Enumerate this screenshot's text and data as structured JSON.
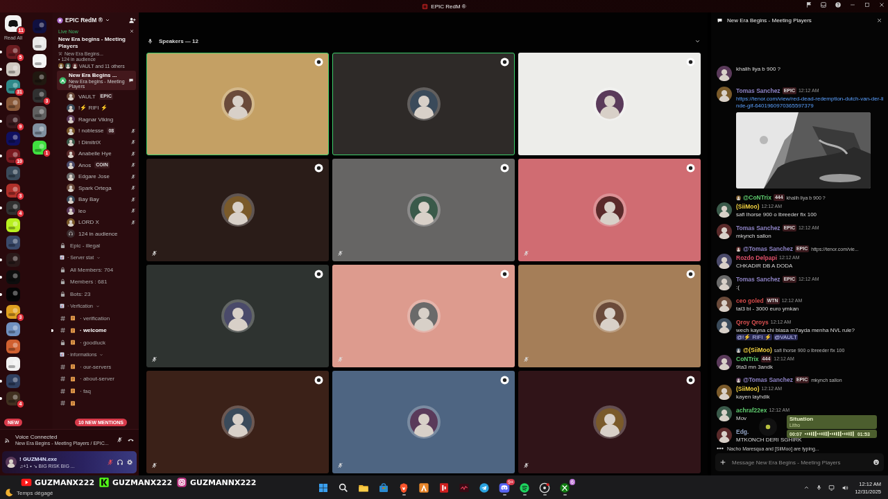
{
  "title_bar": {
    "title": "EPIC RedM ®"
  },
  "server_rail": {
    "home_badge": "11",
    "read_all": "Read All",
    "new_label": "NEW",
    "servers": [
      {
        "color": "#6b1c20",
        "badge": "5",
        "unread": true
      },
      {
        "color": "#cfcac2",
        "unread": true
      },
      {
        "color": "#2f8a8a",
        "badge": "31",
        "unread": true
      },
      {
        "color": "#8a5a3a",
        "unread": true
      },
      {
        "color": "#3a1a1e",
        "badge": "9",
        "unread": true
      },
      {
        "color": "#101060",
        "unread": false
      },
      {
        "color": "#7a1a20",
        "badge": "10",
        "unread": true
      },
      {
        "color": "#3a4a5a",
        "unread": false
      },
      {
        "color": "#b0302a",
        "badge": "3",
        "unread": true
      },
      {
        "color": "#303030",
        "badge": "4",
        "unread": true
      },
      {
        "color": "#b8f020",
        "unread": false
      },
      {
        "color": "#3a4a6a",
        "unread": false
      },
      {
        "color": "#2a1a1a",
        "unread": true
      },
      {
        "color": "#0d0d0d",
        "unread": true
      },
      {
        "color": "#050505",
        "unread": true
      },
      {
        "color": "#e0a020",
        "badge": "3",
        "unread": true
      },
      {
        "color": "#7090c0",
        "unread": false
      },
      {
        "color": "#d06030",
        "unread": false
      },
      {
        "color": "#f0f0f0",
        "unread": false
      },
      {
        "color": "#304060",
        "unread": true
      },
      {
        "color": "#403020",
        "badge": "4",
        "unread": true
      }
    ],
    "folder_servers": [
      {
        "color": "#101040"
      },
      {
        "color": "#e8e8e8"
      },
      {
        "color": "#f4f4f4"
      },
      {
        "color": "#201810"
      },
      {
        "color": "#303030",
        "badge": "3"
      },
      {
        "color": "#606060"
      },
      {
        "color": "#8090a0"
      },
      {
        "color": "#40e040",
        "badge": "1"
      }
    ]
  },
  "channel_sidebar": {
    "server_name": "EPIC RedM ®",
    "live": {
      "label": "Live Now",
      "title": "New Era begins - Meeting Players",
      "channel": "New Era Begins...",
      "audience": "• 124 in audience",
      "participants": "VAULT and 11 others"
    },
    "active_channel": {
      "name": "New Era Begins ...",
      "topic": "New Era begins - Meeting Players"
    },
    "members": [
      {
        "name": "VAULT",
        "tag": "EPIC",
        "muted": false
      },
      {
        "name": "!⚡ RIFI ⚡",
        "muted": false
      },
      {
        "name": "Ragnar Viking",
        "muted": false
      },
      {
        "name": "! noblesse",
        "tag": "08",
        "muted": true
      },
      {
        "name": "! DimitriX",
        "muted": true
      },
      {
        "name": "Anabelle Hye",
        "muted": true
      },
      {
        "name": "Anos",
        "tag": "COIN",
        "muted": true
      },
      {
        "name": "Edgare Jose",
        "muted": true
      },
      {
        "name": "Spark Ortega",
        "muted": true
      },
      {
        "name": "Bay Bay",
        "muted": true
      },
      {
        "name": "leo",
        "muted": true
      },
      {
        "name": "LORD X",
        "muted": true
      }
    ],
    "audience": "124 in audience",
    "channels": [
      {
        "kind": "lock",
        "name": "Epic - illegal"
      },
      {
        "kind": "category",
        "name": "· Server stat"
      },
      {
        "kind": "lock",
        "name": "All Members: 704"
      },
      {
        "kind": "lock",
        "name": "Members : 681"
      },
      {
        "kind": "lock",
        "name": "Bots: 23"
      },
      {
        "kind": "category",
        "name": "· Verfication"
      },
      {
        "kind": "text",
        "name": "· verification",
        "unread": false
      },
      {
        "kind": "text",
        "name": "· welcome",
        "unread": true
      },
      {
        "kind": "lock",
        "name": "· goodluck"
      },
      {
        "kind": "category",
        "name": "· informations"
      },
      {
        "kind": "text",
        "name": "· our-servers",
        "unread": false
      },
      {
        "kind": "text",
        "name": "· about-server",
        "unread": false
      },
      {
        "kind": "text",
        "name": "· faq",
        "unread": false
      },
      {
        "kind": "text",
        "unread": false
      }
    ],
    "mentions_pill": "10 NEW MENTIONS"
  },
  "voice_panel": {
    "status": "Voice Connected",
    "channel": "New Era Begins - Meeting Players / EPIC..."
  },
  "user_panel": {
    "name": "! GUZM4N.exe",
    "activity": "♫+1 • ↘ BIG RISK BIG ..."
  },
  "stage": {
    "heading": "Speakers — 12",
    "tiles": [
      {
        "color": "#c4a064",
        "speaking": true,
        "muted": false
      },
      {
        "color": "#2e2a28",
        "speaking": true,
        "muted": false
      },
      {
        "color": "#ededea",
        "speaking": false,
        "muted": false
      },
      {
        "color": "#2a1c18",
        "speaking": false,
        "muted": true
      },
      {
        "color": "#666564",
        "speaking": false,
        "muted": true
      },
      {
        "color": "#d06c72",
        "speaking": false,
        "muted": true
      },
      {
        "color": "#2e3330",
        "speaking": false,
        "muted": true
      },
      {
        "color": "#dd9b8e",
        "speaking": false,
        "muted": true
      },
      {
        "color": "#a57e58",
        "speaking": false,
        "muted": true
      },
      {
        "color": "#3b2118",
        "speaking": false,
        "muted": true
      },
      {
        "color": "#4e6582",
        "speaking": false,
        "muted": true
      },
      {
        "color": "#301418",
        "speaking": false,
        "muted": true
      }
    ]
  },
  "chat": {
    "title": "New Era Begins - Meeting Players",
    "messages": [
      {
        "text": "khalih liya b 900 ?"
      },
      {
        "author": "Tomas Sanchez",
        "color": "#8d82c4",
        "tag": "EPIC",
        "time": "12:12 AM",
        "link": "https://tenor.com/view/red-dead-redemption-dutch-van-der-linde-gif-6401960970365597379"
      },
      {
        "reply": {
          "author": "@CoNTrix",
          "color": "#5ecb6e",
          "tag": "444",
          "text": "khalih liya b 900 ?"
        },
        "author": "(SiiMoo)",
        "color": "#f0d040",
        "time": "12:12 AM",
        "text": "safi lhorse 900 o lbreeder fix 100"
      },
      {
        "author": "Tomas Sanchez",
        "color": "#8d82c4",
        "tag": "EPIC",
        "time": "12:12 AM",
        "text": "mkynch sallon"
      },
      {
        "reply": {
          "author": "@Tomas Sanchez",
          "color": "#8d82c4",
          "tag": "EPIC",
          "text": "https://tenor.com/vie..."
        },
        "author": "Rozdo Delpapi",
        "color": "#e0506a",
        "time": "12:12 AM",
        "text": "CHKADIR DB A DODA"
      },
      {
        "author": "Tomas Sanchez",
        "color": "#8d82c4",
        "tag": "EPIC",
        "time": "12:12 AM",
        "text": ":("
      },
      {
        "author": "ceo goled",
        "color": "#d04848",
        "tag": "WTN",
        "time": "12:12 AM",
        "text": "tal3 bi - 3000 euro ymkan"
      },
      {
        "author": "Qroy Qroys",
        "color": "#d85050",
        "time": "12:12 AM",
        "text": "wech kayna chi blasa m7ayda menha NVL rule?",
        "mentions": [
          "@!⚡ RIFI ⚡",
          "@VAULT"
        ]
      },
      {
        "reply": {
          "author": "@(SiiMoo)",
          "color": "#f0d040",
          "text": "safi lhorse 900 o lbreeder fix 100"
        },
        "author": "CoNTrix",
        "color": "#5ecb6e",
        "tag": "444",
        "time": "12:12 AM",
        "text": "9ta3 mn 3andk"
      },
      {
        "reply": {
          "author": "@Tomas Sanchez",
          "color": "#8d82c4",
          "tag": "EPIC",
          "text": "mkynch sallon"
        },
        "author": "(SiiMoo)",
        "color": "#f0d040",
        "time": "12:12 AM",
        "text": "kayen layhdik"
      },
      {
        "author": "achraf22ex",
        "color": "#5ecb6e",
        "time": "12:12 AM",
        "text": "Mov"
      },
      {
        "author": "Edg.",
        "color": "#8fa0c0",
        "text": "MTKONCH DERI SGHIRK"
      }
    ],
    "typing": "Nacho Maresqua and [SiiMoo] are typing...",
    "placeholder": "Message New Era Begins - Meeting Players"
  },
  "now_playing": {
    "title": "Situation",
    "artist": "Litho",
    "elapsed": "00:07",
    "duration": "01:53"
  },
  "stream_overlay": {
    "handles": [
      {
        "kind": "youtube",
        "text": "GUZMANX222"
      },
      {
        "kind": "kick",
        "text": "GUZMANX222"
      },
      {
        "kind": "instagram",
        "text": "GUZMANNX222"
      }
    ]
  },
  "taskbar": {
    "weather": "Temps dégagé",
    "apps": [
      {
        "kind": "start",
        "running": false
      },
      {
        "kind": "search",
        "running": false
      },
      {
        "kind": "folder",
        "running": false
      },
      {
        "kind": "store",
        "running": false
      },
      {
        "kind": "brave",
        "running": true
      },
      {
        "kind": "triangle",
        "running": false
      },
      {
        "kind": "red",
        "running": false
      },
      {
        "kind": "wave",
        "running": false
      },
      {
        "kind": "telegram",
        "running": false
      },
      {
        "kind": "discord",
        "badge": "9+",
        "running": true
      },
      {
        "kind": "spotify",
        "running": true
      },
      {
        "kind": "steam",
        "running": true
      },
      {
        "kind": "xbox",
        "badge": "6",
        "running": true
      }
    ],
    "time": "12:12 AM",
    "date": "12/31/2025"
  }
}
